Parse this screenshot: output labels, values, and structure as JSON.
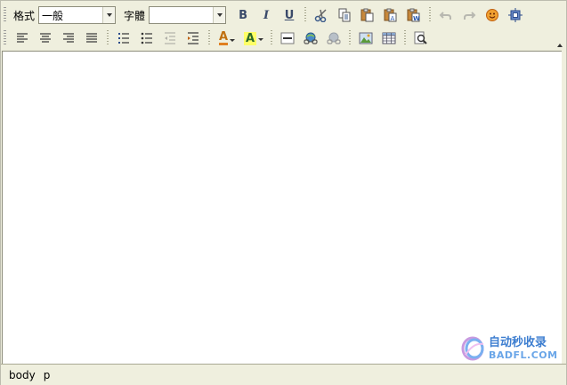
{
  "toolbar": {
    "format_label": "格式",
    "format_value": "一般",
    "font_label": "字體",
    "font_value": "",
    "bold_label": "B",
    "italic_label": "I",
    "underline_label": "U",
    "font_color_label": "A",
    "highlight_label": "A",
    "icons_row1": [
      "bold-icon",
      "italic-icon",
      "underline-icon",
      "cut-icon",
      "copy-icon",
      "paste-icon",
      "paste-text-icon",
      "paste-word-icon",
      "undo-icon",
      "redo-icon",
      "emoticon-icon",
      "special-char-icon"
    ],
    "icons_row2": [
      "align-left-icon",
      "align-center-icon",
      "align-right-icon",
      "align-justify-icon",
      "ordered-list-icon",
      "unordered-list-icon",
      "outdent-icon",
      "indent-icon",
      "font-color-icon",
      "highlight-color-icon",
      "horizontal-rule-icon",
      "link-icon",
      "unlink-icon",
      "image-icon",
      "table-icon",
      "find-icon"
    ]
  },
  "statusbar": {
    "path": [
      "body",
      "p"
    ]
  },
  "watermark": {
    "line1": "自动秒收录",
    "line2": "BADFL.COM"
  },
  "colors": {
    "toolbar_bg": "#efefde",
    "content_bg": "#ffffff",
    "highlight_yellow": "#ffff66",
    "icon_blue": "#3a5a8a"
  }
}
